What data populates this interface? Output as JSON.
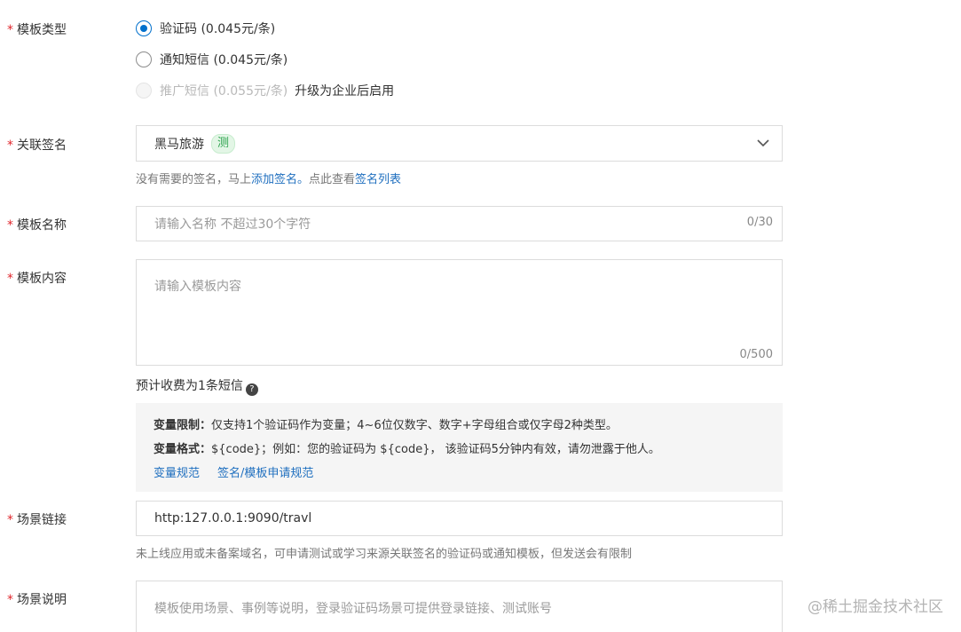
{
  "template_type": {
    "label": "模板类型",
    "options": [
      {
        "label": "验证码 (0.045元/条)",
        "checked": true,
        "disabled": false
      },
      {
        "label": "通知短信 (0.045元/条)",
        "checked": false,
        "disabled": false
      },
      {
        "label": "推广短信 (0.055元/条)",
        "checked": false,
        "disabled": true,
        "note": "升级为企业后启用"
      }
    ]
  },
  "signature": {
    "label": "关联签名",
    "value": "黑马旅游",
    "tag": "测",
    "help_prefix": "没有需要的签名，马上",
    "help_link1": "添加签名。",
    "help_middle": "点此查看",
    "help_link2": "签名列表"
  },
  "template_name": {
    "label": "模板名称",
    "placeholder": "请输入名称 不超过30个字符",
    "counter": "0/30"
  },
  "template_content": {
    "label": "模板内容",
    "placeholder": "请输入模板内容",
    "counter": "0/500",
    "fee_text": "预计收费为1条短信",
    "fee_icon": "question-icon"
  },
  "notice": {
    "restriction_title": "变量限制：",
    "restriction_text": "仅支持1个验证码作为变量；4~6位仅数字、数字+字母组合或仅字母2种类型。",
    "format_title": "变量格式：",
    "format_text": "${code}；例如：您的验证码为 ${code}， 该验证码5分钟内有效，请勿泄露于他人。",
    "link1": "变量规范",
    "link2": "签名/模板申请规范"
  },
  "scene_link": {
    "label": "场景链接",
    "value": "http:127.0.0.1:9090/travl",
    "help": "未上线应用或未备案域名，可申请测试或学习来源关联签名的验证码或通知模板，但发送会有限制"
  },
  "scene_desc": {
    "label": "场景说明",
    "placeholder": "模板使用场景、事例等说明，登录验证码场景可提供登录链接、测试账号"
  },
  "watermark": "@稀土掘金技术社区",
  "colors": {
    "primary": "#0070cc",
    "link": "#1f6fbf",
    "required": "#e0262c",
    "tag_bg": "#e3f6e6",
    "tag_text": "#2ea44f"
  }
}
